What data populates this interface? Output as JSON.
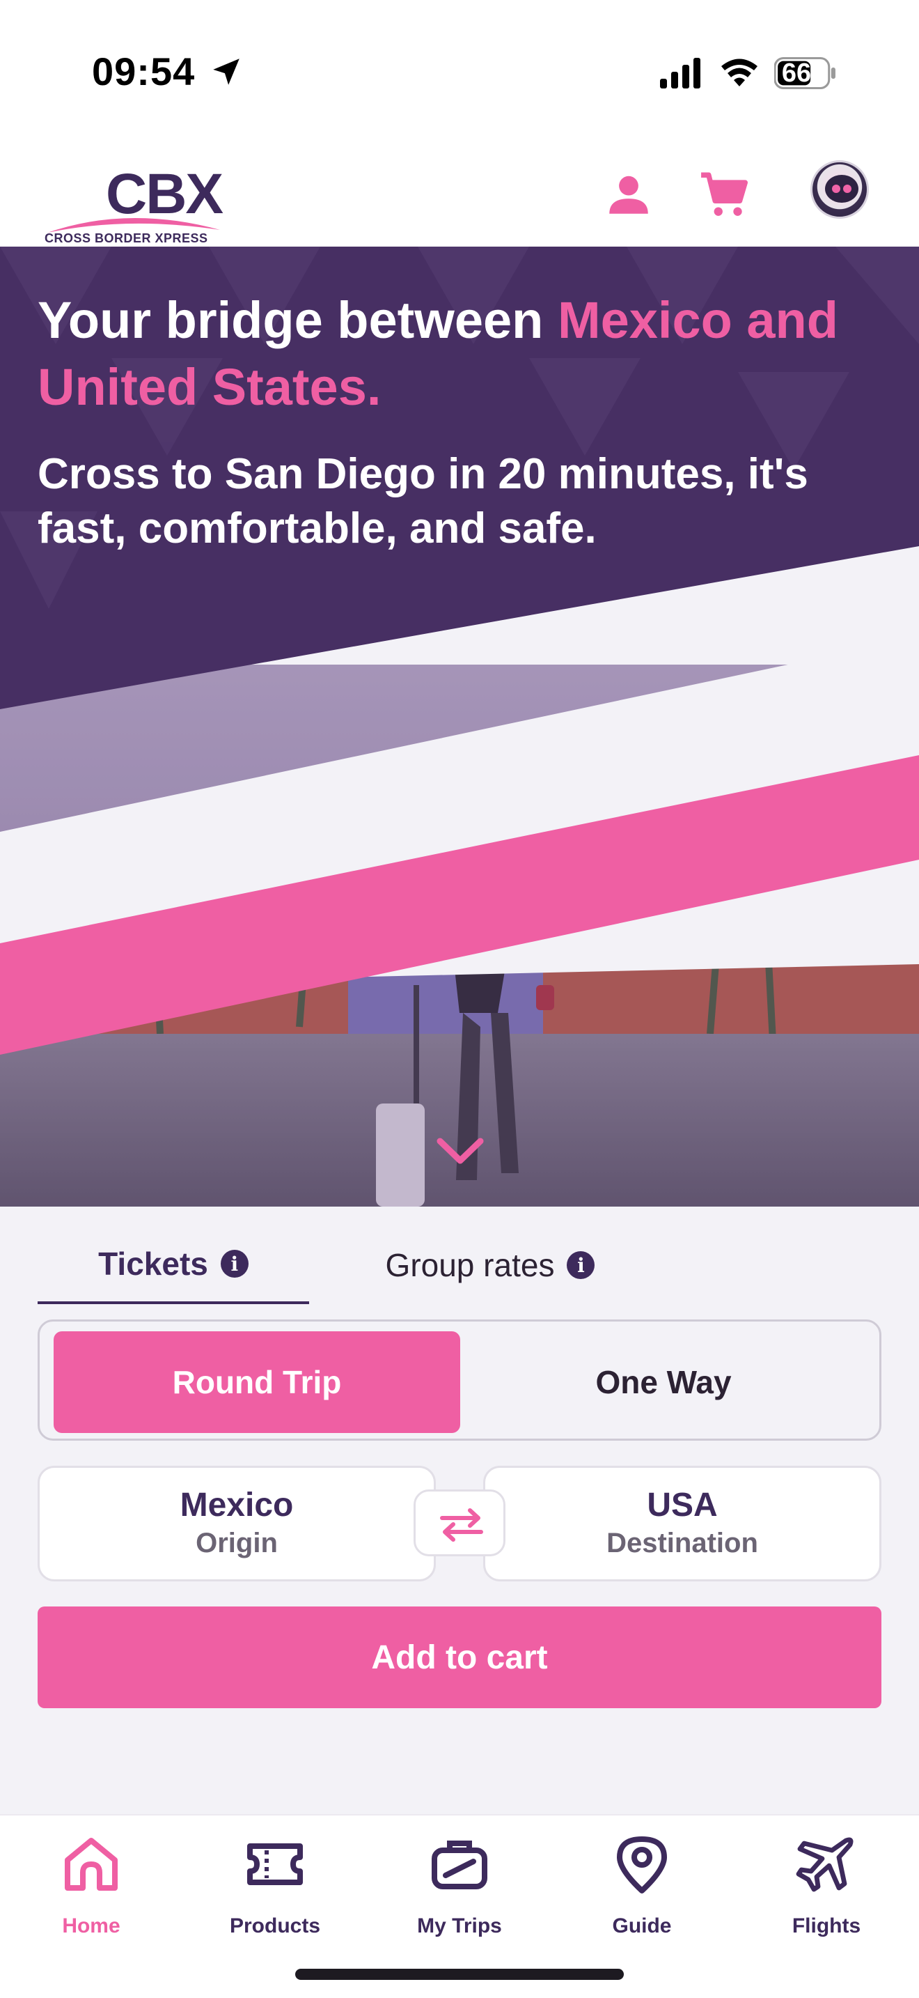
{
  "status_bar": {
    "time": "09:54",
    "battery": "66"
  },
  "header": {
    "logo_text": "CBX",
    "logo_subtitle": "CROSS BORDER XPRESS",
    "icons": [
      "user-icon",
      "cart-icon",
      "assistant-avatar"
    ]
  },
  "hero": {
    "title_part1": "Your bridge between ",
    "title_highlight": "Mexico and United States.",
    "subtitle": "Cross to San Diego in 20 minutes, it's fast, comfortable, and safe."
  },
  "booking": {
    "tabs": [
      {
        "label": "Tickets",
        "active": true
      },
      {
        "label": "Group rates",
        "active": false
      }
    ],
    "trip_types": [
      {
        "label": "Round Trip",
        "selected": true
      },
      {
        "label": "One Way",
        "selected": false
      }
    ],
    "origin": {
      "name": "Mexico",
      "role": "Origin"
    },
    "destination": {
      "name": "USA",
      "role": "Destination"
    },
    "add_to_cart": "Add to cart"
  },
  "nav": [
    {
      "label": "Home",
      "icon": "home-icon",
      "active": true
    },
    {
      "label": "Products",
      "icon": "ticket-icon",
      "active": false
    },
    {
      "label": "My Trips",
      "icon": "luggage-icon",
      "active": false
    },
    {
      "label": "Guide",
      "icon": "location-pin-icon",
      "active": false
    },
    {
      "label": "Flights",
      "icon": "plane-icon",
      "active": false
    }
  ],
  "colors": {
    "brand_purple": "#3d2a5c",
    "brand_pink": "#ef5fa3",
    "hero_purple": "#472f63",
    "background": "#f3f2f7"
  }
}
